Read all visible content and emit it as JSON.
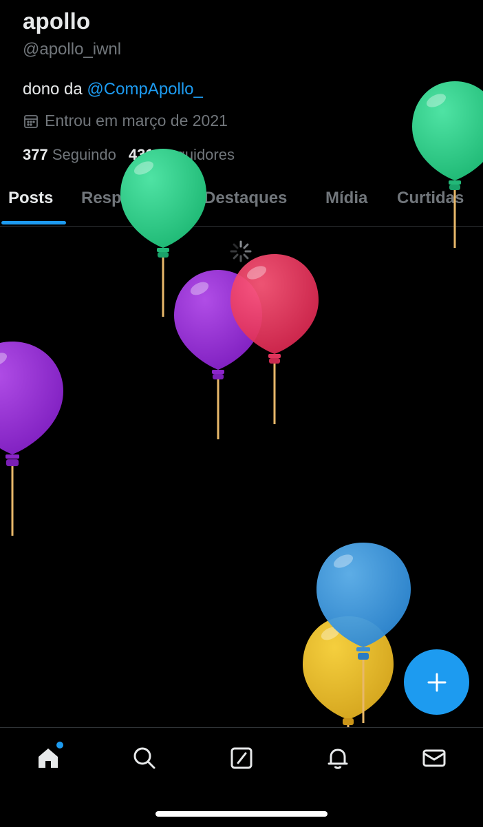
{
  "profile": {
    "name": "apollo",
    "handle": "@apollo_iwnl",
    "bio_prefix": "dono da ",
    "bio_mention": "@CompApollo_",
    "joined": "Entrou em março de 2021",
    "following_count": "377",
    "following_label": "Seguindo",
    "followers_count": "431",
    "followers_label": "Seguidores"
  },
  "tabs": [
    {
      "label": "Posts",
      "active": true
    },
    {
      "label": "Respostas",
      "active": false
    },
    {
      "label": "Destaques",
      "active": false
    },
    {
      "label": "Mídia",
      "active": false
    },
    {
      "label": "Curtidas",
      "active": false
    }
  ],
  "colors": {
    "accent": "#1d9bf0",
    "background": "#000000",
    "secondary_text": "#71767b",
    "balloon_green": "#2fcf8a",
    "balloon_purple": "#9b2fd0",
    "balloon_red": "#ee3a64",
    "balloon_blue": "#3f9fe3",
    "balloon_yellow": "#e2b92a"
  },
  "icons": {
    "fab": "plus-icon",
    "calendar": "calendar-icon",
    "nav": [
      "home-icon",
      "search-icon",
      "grok-icon",
      "bell-icon",
      "mail-icon"
    ]
  }
}
